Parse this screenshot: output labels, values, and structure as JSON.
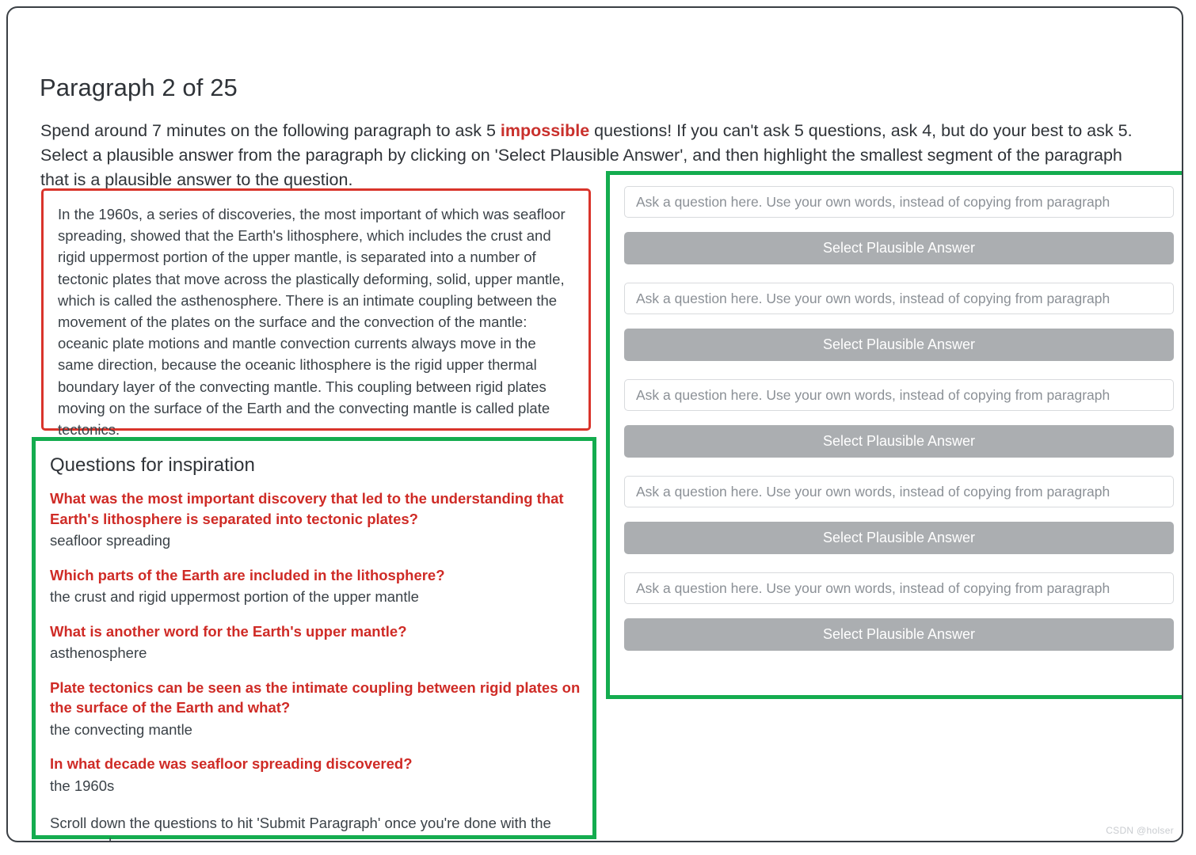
{
  "header": {
    "title": "Paragraph 2 of 25",
    "instruction_part1": "Spend around 7 minutes on the following paragraph to ask 5 ",
    "instruction_highlight": "impossible",
    "instruction_part2": " questions! If you can't ask 5 questions, ask 4, but do your best to ask 5. Select a plausible answer from the paragraph by clicking on 'Select Plausible Answer', and then highlight the smallest segment of the paragraph that is a plausible answer to the question."
  },
  "paragraph": {
    "text": "In the 1960s, a series of discoveries, the most important of which was seafloor spreading, showed that the Earth's lithosphere, which includes the crust and rigid uppermost portion of the upper mantle, is separated into a number of tectonic plates that move across the plastically deforming, solid, upper mantle, which is called the asthenosphere. There is an intimate coupling between the movement of the plates on the surface and the convection of the mantle: oceanic plate motions and mantle convection currents always move in the same direction, because the oceanic lithosphere is the rigid upper thermal boundary layer of the convecting mantle. This coupling between rigid plates moving on the surface of the Earth and the convecting mantle is called plate tectonics."
  },
  "inspiration": {
    "title": "Questions for inspiration",
    "items": [
      {
        "question": "What was the most important discovery that led to the understanding that Earth's lithosphere is separated into tectonic plates?",
        "answer": "seafloor spreading"
      },
      {
        "question": "Which parts of the Earth are included in the lithosphere?",
        "answer": "the crust and rigid uppermost portion of the upper mantle"
      },
      {
        "question": "What is another word for the Earth's upper mantle?",
        "answer": "asthenosphere"
      },
      {
        "question": "Plate tectonics can be seen as the intimate coupling between rigid plates on the surface of the Earth and what?",
        "answer": "the convecting mantle"
      },
      {
        "question": "In what decade was seafloor spreading discovered?",
        "answer": "the 1960s"
      }
    ],
    "footer": "Scroll down the questions to hit 'Submit Paragraph' once you're done with the paragraph."
  },
  "answer_panel": {
    "rows": [
      {
        "input_placeholder": "Ask a question here. Use your own words, instead of copying from paragraph",
        "input_value": "",
        "button_label": "Select Plausible Answer"
      },
      {
        "input_placeholder": "Ask a question here. Use your own words, instead of copying from paragraph",
        "input_value": "",
        "button_label": "Select Plausible Answer"
      },
      {
        "input_placeholder": "Ask a question here. Use your own words, instead of copying from paragraph",
        "input_value": "",
        "button_label": "Select Plausible Answer"
      },
      {
        "input_placeholder": "Ask a question here. Use your own words, instead of copying from paragraph",
        "input_value": "",
        "button_label": "Select Plausible Answer"
      },
      {
        "input_placeholder": "Ask a question here. Use your own words, instead of copying from paragraph",
        "input_value": "",
        "button_label": "Select Plausible Answer"
      }
    ]
  },
  "watermark": {
    "text": "CSDN @holser"
  },
  "colors": {
    "accent_green": "#14ac4f",
    "accent_red": "#d9342b",
    "question_red": "#cf2b26",
    "button_gray": "#abaeb1",
    "text_dark": "#2f3338"
  }
}
